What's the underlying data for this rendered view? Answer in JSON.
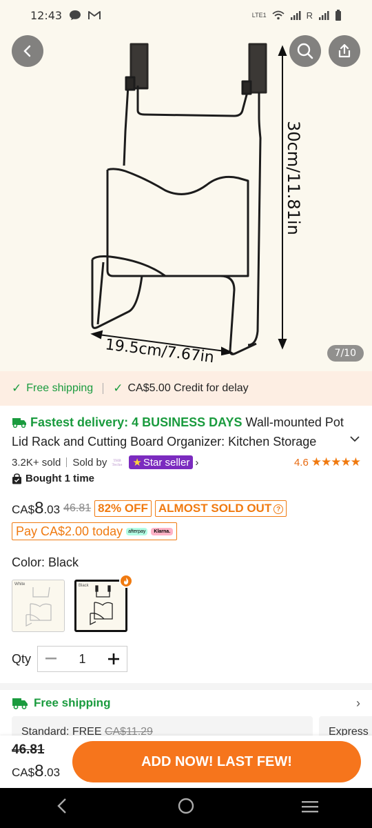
{
  "status_bar": {
    "time": "12:43",
    "carrier_label": "LTE1",
    "roaming": "R"
  },
  "gallery": {
    "counter": "7/10",
    "dimension_height": "30cm/11.81in",
    "dimension_width": "19.5cm/7.67in"
  },
  "promo": {
    "free_shipping": "Free shipping",
    "credit_for_delay": "CA$5.00 Credit for delay"
  },
  "product": {
    "fastest_delivery": "Fastest delivery: 4 BUSINESS DAYS",
    "title": "Wall-mounted Pot Lid Rack and Cutting Board Organizer: Kitchen Storage",
    "sold": "3.2K+ sold",
    "sold_by": "Sold by",
    "store_logo_text": "THB Teche",
    "star_seller": "Star seller",
    "rating": "4.6",
    "bought": "Bought 1 time"
  },
  "price": {
    "currency": "CA$",
    "whole": "8",
    "cents": ".03",
    "original": "46.81",
    "discount": "82% OFF",
    "almost_sold_out": "ALMOST SOLD OUT",
    "pay_today": "Pay CA$2.00 today",
    "afterpay": "afterpay",
    "klarna": "Klarna."
  },
  "color": {
    "label": "Color: Black",
    "options": [
      {
        "label": "White"
      },
      {
        "label": "Black"
      }
    ],
    "selected": "Black"
  },
  "quantity": {
    "label": "Qty",
    "value": "1"
  },
  "shipping": {
    "title": "Free shipping",
    "standard": "Standard: FREE",
    "standard_old": "CA$11.29",
    "express": "Express"
  },
  "action_bar": {
    "old_price": "46.81",
    "currency": "CA$",
    "whole": "8",
    "cents": ".03",
    "button": "ADD NOW! LAST FEW!"
  },
  "colors": {
    "accent": "#f6751c",
    "green": "#1a9b3e",
    "star_seller": "#7b2bbf",
    "image_bg": "#fbf8ee"
  }
}
